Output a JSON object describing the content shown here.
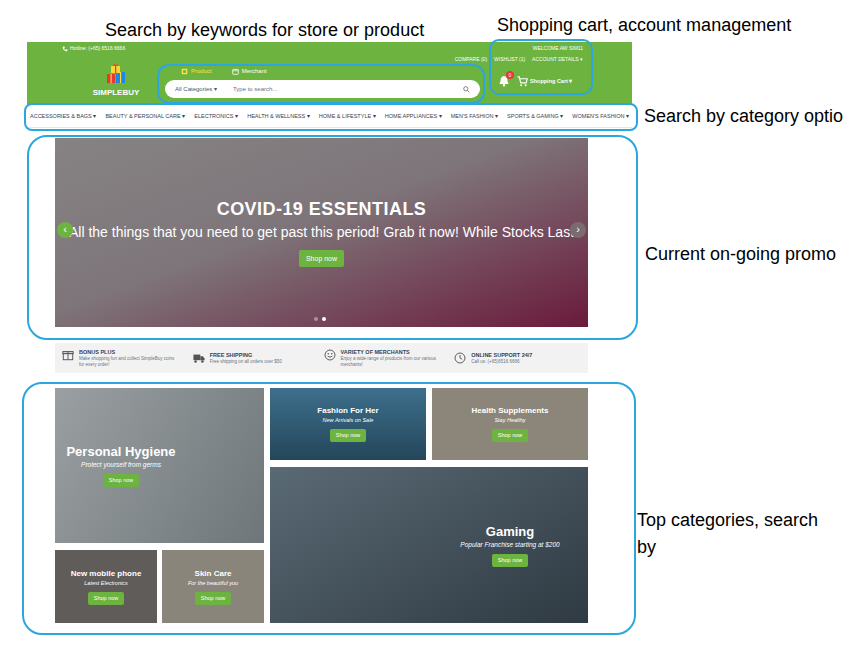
{
  "annotations": [
    {
      "text": "Search by keywords for store or product"
    },
    {
      "text": "Shopping cart, account management"
    },
    {
      "text": "Search by category optio"
    },
    {
      "text": "Current on-going promo"
    },
    {
      "text": "Top categories, search by"
    }
  ],
  "site": {
    "hotline": "Hotline: (+65) 6516 6666",
    "welcome": "WELCOME AW SIM11",
    "top_links": [
      "COMPARE (0)",
      "WISHLIST (1)",
      "ACCOUNT DETAILS ▾"
    ],
    "logo": "SIMPLEBUY",
    "search_tabs": [
      {
        "label": "Product",
        "selected": true
      },
      {
        "label": "Merchant",
        "selected": false
      }
    ],
    "category_select": "All Categories ▾",
    "search_placeholder": "Type to search...",
    "notification_count": "0",
    "cart": "Shopping Cart ▾"
  },
  "nav": [
    "ACCESSORIES & BAGS ▾",
    "BEAUTY & PERSONAL CARE ▾",
    "ELECTRONICS ▾",
    "HEALTH & WELLNESS ▾",
    "HOME & LIFESTYLE ▾",
    "HOME APPLIANCES ▾",
    "MEN'S FASHION ▾",
    "SPORTS & GAMING ▾",
    "WOMEN'S FASHION ▾"
  ],
  "banner": {
    "title": "COVID-19 ESSENTIALS",
    "subtitle": "All the things that you need to get past this period! Grab it now! While Stocks Last",
    "button": "Shop now",
    "prev": "‹",
    "next": "›",
    "slides": [
      {
        "selected": false
      },
      {
        "selected": true
      }
    ]
  },
  "features": [
    {
      "title": "BONUS PLUS",
      "text": "Make shopping fun and collect SimpleBuy coins for every order!"
    },
    {
      "title": "FREE SHIPPING",
      "text": "Free shipping on all orders over $50"
    },
    {
      "title": "VARIETY OF MERCHANTS",
      "text": "Enjoy a wide range of products from our various merchants!"
    },
    {
      "title": "ONLINE SUPPORT 24/7",
      "text": "Call us: (+65)6516 6666"
    }
  ],
  "tiles": [
    {
      "kind": "large",
      "title": "Personal Hygiene",
      "subtitle": "Protect yourself from germs",
      "button": "Shop now"
    },
    {
      "kind": "small",
      "title": "Fashion For Her",
      "subtitle": "New Arrivals on Sale",
      "button": "Shop now"
    },
    {
      "kind": "small",
      "title": "Health Supplements",
      "subtitle": "Stay Healthy",
      "button": "Shop now"
    },
    {
      "kind": "large",
      "title": "Gaming",
      "subtitle": "Popular Franchise starting at $200",
      "button": "Shop now"
    },
    {
      "kind": "small",
      "title": "New mobile phone",
      "subtitle": "Latest Electronics",
      "button": "Shop now"
    },
    {
      "kind": "small",
      "title": "Skin Care",
      "subtitle": "For the beautiful you",
      "button": "Shop now"
    }
  ]
}
